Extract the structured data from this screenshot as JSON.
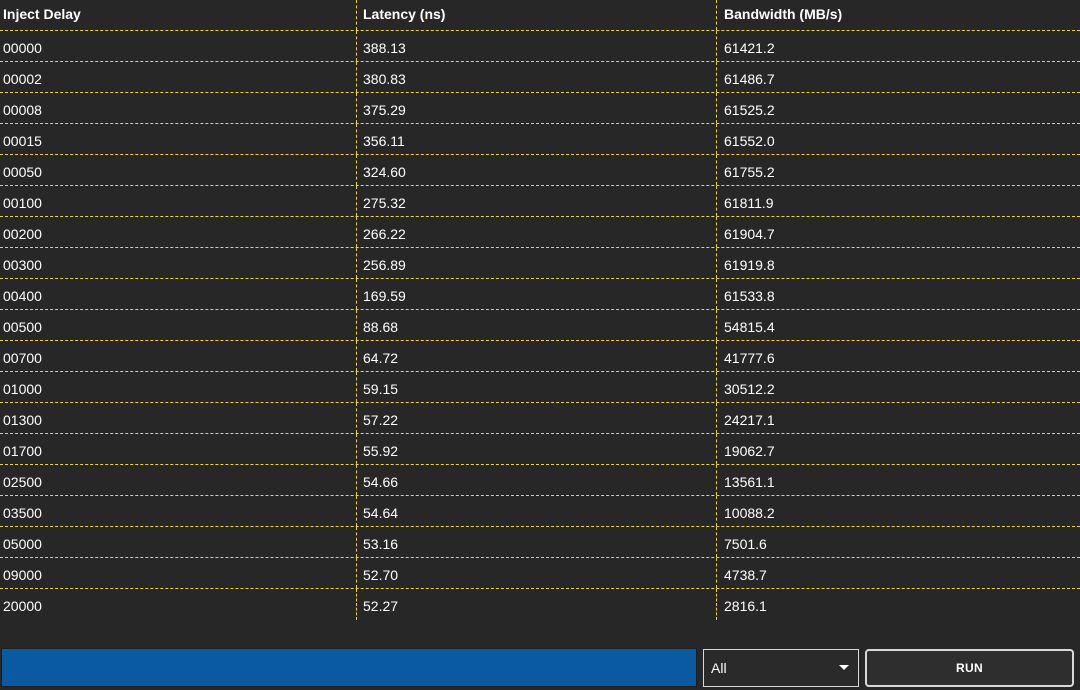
{
  "table": {
    "columns": [
      "Inject Delay",
      "Latency (ns)",
      "Bandwidth (MB/s)"
    ],
    "rows": [
      [
        "00000",
        "388.13",
        "61421.2"
      ],
      [
        "00002",
        "380.83",
        "61486.7"
      ],
      [
        "00008",
        "375.29",
        "61525.2"
      ],
      [
        "00015",
        "356.11",
        "61552.0"
      ],
      [
        "00050",
        "324.60",
        "61755.2"
      ],
      [
        "00100",
        "275.32",
        "61811.9"
      ],
      [
        "00200",
        "266.22",
        "61904.7"
      ],
      [
        "00300",
        "256.89",
        "61919.8"
      ],
      [
        "00400",
        "169.59",
        "61533.8"
      ],
      [
        "00500",
        "88.68",
        "54815.4"
      ],
      [
        "00700",
        "64.72",
        "41777.6"
      ],
      [
        "01000",
        "59.15",
        "30512.2"
      ],
      [
        "01300",
        "57.22",
        "24217.1"
      ],
      [
        "01700",
        "55.92",
        "19062.7"
      ],
      [
        "02500",
        "54.66",
        "13561.1"
      ],
      [
        "03500",
        "54.64",
        "10088.2"
      ],
      [
        "05000",
        "53.16",
        "7501.6"
      ],
      [
        "09000",
        "52.70",
        "4738.7"
      ],
      [
        "20000",
        "52.27",
        "2816.1"
      ]
    ]
  },
  "progress": {
    "fraction": 1.0,
    "fill_color": "#0a5aa2"
  },
  "mode_select": {
    "selected": "All",
    "icon": "chevron-down-icon"
  },
  "run_button": {
    "label": "RUN"
  },
  "colors": {
    "background": "#272727",
    "grid_line": "#e6d83a",
    "text": "#ffffff"
  }
}
